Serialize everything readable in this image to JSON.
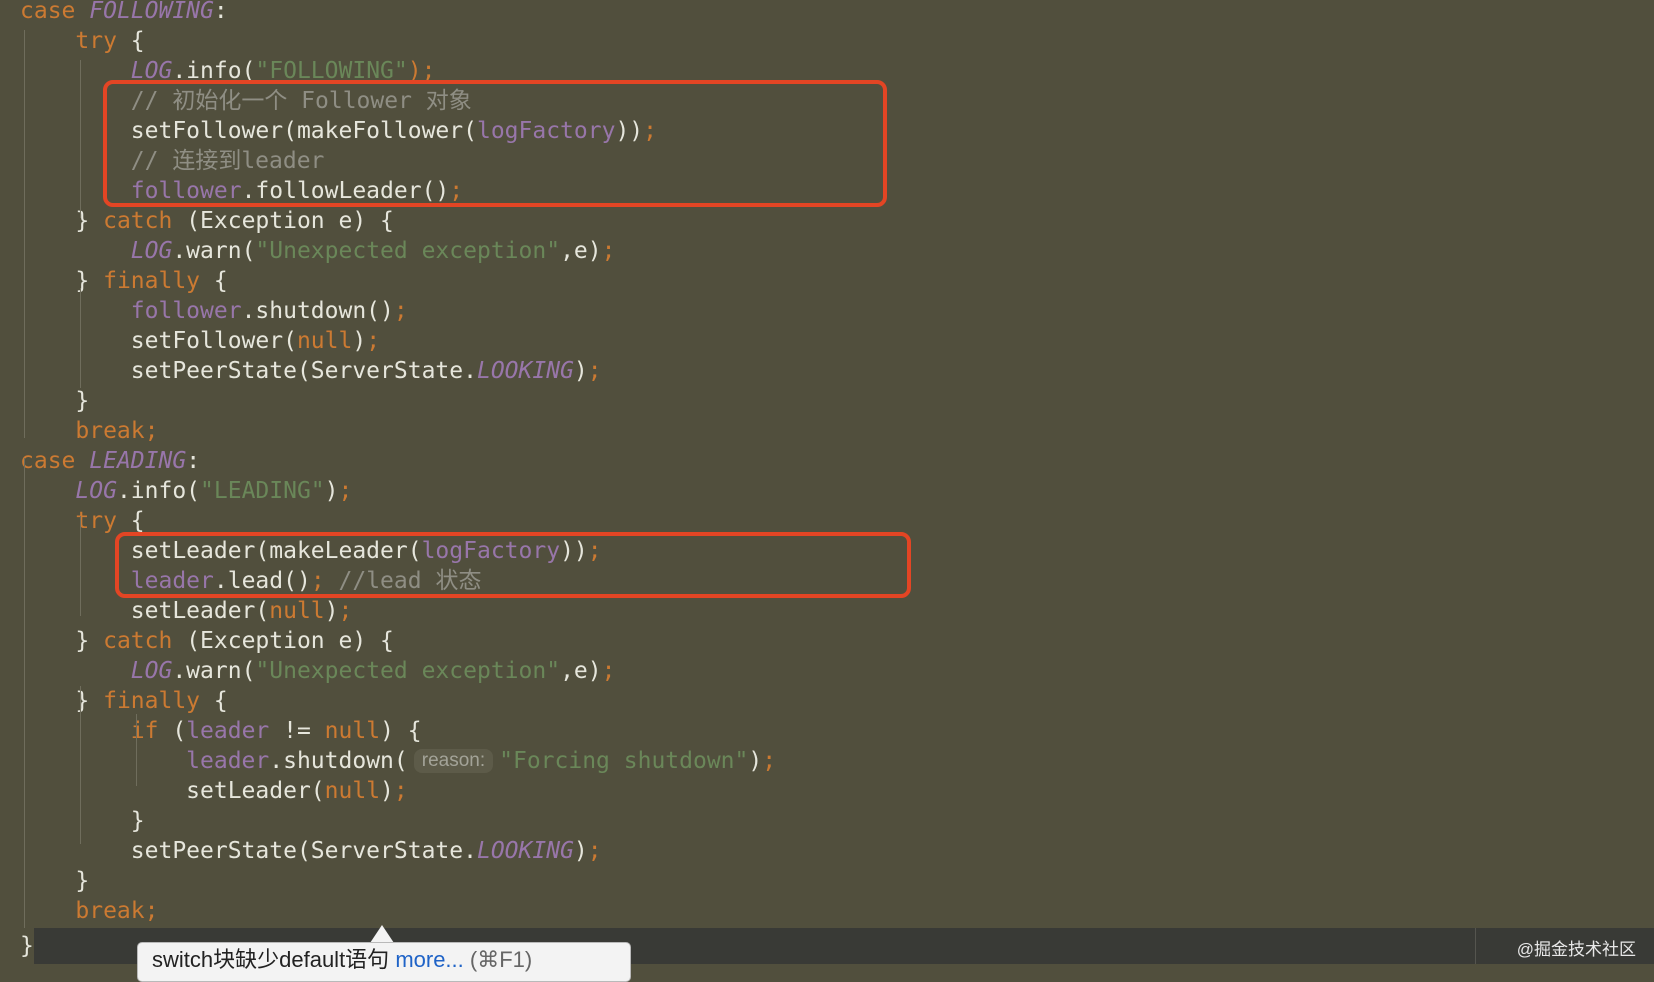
{
  "code_lines": [
    {
      "tokens": [
        {
          "t": "case ",
          "c": "kw"
        },
        {
          "t": "FOLLOWING",
          "c": "const"
        },
        {
          "t": ":",
          "c": "plain"
        }
      ]
    },
    {
      "tokens": [
        {
          "t": "    "
        },
        {
          "t": "try ",
          "c": "kw"
        },
        {
          "t": "{",
          "c": "plain"
        }
      ]
    },
    {
      "tokens": [
        {
          "t": "        "
        },
        {
          "t": "LOG",
          "c": "const"
        },
        {
          "t": ".info(",
          "c": "plain"
        },
        {
          "t": "\"FOLLOWING\"",
          "c": "str"
        },
        {
          "t": ");",
          "c": "punc"
        }
      ]
    },
    {
      "tokens": [
        {
          "t": "        "
        },
        {
          "t": "// 初始化一个 Follower 对象",
          "c": "cmt"
        }
      ]
    },
    {
      "tokens": [
        {
          "t": "        "
        },
        {
          "t": "setFollower(makeFollower(",
          "c": "plain"
        },
        {
          "t": "logFactory",
          "c": "field"
        },
        {
          "t": "))",
          "c": "plain"
        },
        {
          "t": ";",
          "c": "punc"
        }
      ]
    },
    {
      "tokens": [
        {
          "t": "        "
        },
        {
          "t": "// 连接到leader",
          "c": "cmt"
        }
      ]
    },
    {
      "tokens": [
        {
          "t": "        "
        },
        {
          "t": "follower",
          "c": "field"
        },
        {
          "t": ".followLeader()",
          "c": "plain"
        },
        {
          "t": ";",
          "c": "punc"
        }
      ]
    },
    {
      "tokens": [
        {
          "t": "    "
        },
        {
          "t": "} ",
          "c": "plain"
        },
        {
          "t": "catch ",
          "c": "kw"
        },
        {
          "t": "(Exception e) {",
          "c": "plain"
        }
      ]
    },
    {
      "tokens": [
        {
          "t": "        "
        },
        {
          "t": "LOG",
          "c": "const"
        },
        {
          "t": ".warn(",
          "c": "plain"
        },
        {
          "t": "\"Unexpected exception\"",
          "c": "str"
        },
        {
          "t": ",e)",
          "c": "plain"
        },
        {
          "t": ";",
          "c": "punc"
        }
      ]
    },
    {
      "tokens": [
        {
          "t": "    "
        },
        {
          "t": "} ",
          "c": "plain"
        },
        {
          "t": "finally ",
          "c": "kw"
        },
        {
          "t": "{",
          "c": "plain"
        }
      ]
    },
    {
      "tokens": [
        {
          "t": "        "
        },
        {
          "t": "follower",
          "c": "field"
        },
        {
          "t": ".shutdown()",
          "c": "plain"
        },
        {
          "t": ";",
          "c": "punc"
        }
      ]
    },
    {
      "tokens": [
        {
          "t": "        "
        },
        {
          "t": "setFollower(",
          "c": "plain"
        },
        {
          "t": "null",
          "c": "kw"
        },
        {
          "t": ")",
          "c": "plain"
        },
        {
          "t": ";",
          "c": "punc"
        }
      ]
    },
    {
      "tokens": [
        {
          "t": "        "
        },
        {
          "t": "setPeerState(ServerState.",
          "c": "plain"
        },
        {
          "t": "LOOKING",
          "c": "const"
        },
        {
          "t": ")",
          "c": "plain"
        },
        {
          "t": ";",
          "c": "punc"
        }
      ]
    },
    {
      "tokens": [
        {
          "t": "    "
        },
        {
          "t": "}",
          "c": "plain"
        }
      ]
    },
    {
      "tokens": [
        {
          "t": "    "
        },
        {
          "t": "break;",
          "c": "kw"
        }
      ]
    },
    {
      "tokens": [
        {
          "t": "case ",
          "c": "kw"
        },
        {
          "t": "LEADING",
          "c": "const"
        },
        {
          "t": ":",
          "c": "plain"
        }
      ]
    },
    {
      "tokens": [
        {
          "t": "    "
        },
        {
          "t": "LOG",
          "c": "const"
        },
        {
          "t": ".info(",
          "c": "plain"
        },
        {
          "t": "\"LEADING\"",
          "c": "str"
        },
        {
          "t": ")",
          "c": "plain"
        },
        {
          "t": ";",
          "c": "punc"
        }
      ]
    },
    {
      "tokens": [
        {
          "t": "    "
        },
        {
          "t": "try ",
          "c": "kw"
        },
        {
          "t": "{",
          "c": "plain"
        }
      ]
    },
    {
      "tokens": [
        {
          "t": "        "
        },
        {
          "t": "setLeader(makeLeader(",
          "c": "plain"
        },
        {
          "t": "logFactory",
          "c": "field"
        },
        {
          "t": "))",
          "c": "plain"
        },
        {
          "t": ";",
          "c": "punc"
        }
      ]
    },
    {
      "tokens": [
        {
          "t": "        "
        },
        {
          "t": "leader",
          "c": "field"
        },
        {
          "t": ".lead()",
          "c": "plain"
        },
        {
          "t": "; ",
          "c": "punc"
        },
        {
          "t": "//lead 状态",
          "c": "cmt"
        }
      ]
    },
    {
      "tokens": [
        {
          "t": "        "
        },
        {
          "t": "setLeader(",
          "c": "plain"
        },
        {
          "t": "null",
          "c": "kw"
        },
        {
          "t": ")",
          "c": "plain"
        },
        {
          "t": ";",
          "c": "punc"
        }
      ]
    },
    {
      "tokens": [
        {
          "t": "    "
        },
        {
          "t": "} ",
          "c": "plain"
        },
        {
          "t": "catch ",
          "c": "kw"
        },
        {
          "t": "(Exception e) {",
          "c": "plain"
        }
      ]
    },
    {
      "tokens": [
        {
          "t": "        "
        },
        {
          "t": "LOG",
          "c": "const"
        },
        {
          "t": ".warn(",
          "c": "plain"
        },
        {
          "t": "\"Unexpected exception\"",
          "c": "str"
        },
        {
          "t": ",e)",
          "c": "plain"
        },
        {
          "t": ";",
          "c": "punc"
        }
      ]
    },
    {
      "tokens": [
        {
          "t": "    "
        },
        {
          "t": "} ",
          "c": "plain"
        },
        {
          "t": "finally ",
          "c": "kw"
        },
        {
          "t": "{",
          "c": "plain"
        }
      ]
    },
    {
      "tokens": [
        {
          "t": "        "
        },
        {
          "t": "if ",
          "c": "kw"
        },
        {
          "t": "(",
          "c": "plain"
        },
        {
          "t": "leader",
          "c": "field"
        },
        {
          "t": " != ",
          "c": "plain"
        },
        {
          "t": "null",
          "c": "kw"
        },
        {
          "t": ") {",
          "c": "plain"
        }
      ]
    },
    {
      "tokens": [
        {
          "t": "            "
        },
        {
          "t": "leader",
          "c": "field"
        },
        {
          "t": ".shutdown(",
          "c": "plain"
        },
        {
          "t": "reason:",
          "c": "hint"
        },
        {
          "t": "\"Forcing shutdown\"",
          "c": "str"
        },
        {
          "t": ")",
          "c": "plain"
        },
        {
          "t": ";",
          "c": "punc"
        }
      ]
    },
    {
      "tokens": [
        {
          "t": "            "
        },
        {
          "t": "setLeader(",
          "c": "plain"
        },
        {
          "t": "null",
          "c": "kw"
        },
        {
          "t": ")",
          "c": "plain"
        },
        {
          "t": ";",
          "c": "punc"
        }
      ]
    },
    {
      "tokens": [
        {
          "t": "        "
        },
        {
          "t": "}",
          "c": "plain"
        }
      ]
    },
    {
      "tokens": [
        {
          "t": "        "
        },
        {
          "t": "setPeerState(ServerState.",
          "c": "plain"
        },
        {
          "t": "LOOKING",
          "c": "const"
        },
        {
          "t": ")",
          "c": "plain"
        },
        {
          "t": ";",
          "c": "punc"
        }
      ]
    },
    {
      "tokens": [
        {
          "t": "    "
        },
        {
          "t": "}",
          "c": "plain"
        }
      ]
    },
    {
      "tokens": [
        {
          "t": "    "
        },
        {
          "t": "break;",
          "c": "kw"
        }
      ]
    }
  ],
  "closing_brace": "}",
  "tooltip": {
    "text": "switch块缺少default语句",
    "more_link": "more...",
    "shortcut": "(⌘F1)"
  },
  "watermark": "@掘金技术社区",
  "colors": {
    "editor_background": "#514f3d",
    "keyword": "#cc7a32",
    "constant": "#9876aa",
    "string": "#6a8759",
    "comment": "#8f8e84",
    "highlight_box": "#e34524"
  }
}
